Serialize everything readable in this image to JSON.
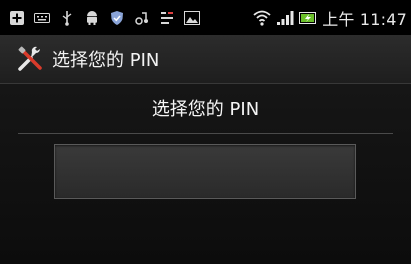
{
  "status_bar": {
    "left_icons": [
      "add-icon",
      "keyboard-icon",
      "usb-icon",
      "android-icon",
      "shield-icon",
      "sync-icon",
      "notification-icon",
      "image-icon"
    ],
    "right_icons": [
      "wifi-icon",
      "signal-icon",
      "battery-icon"
    ],
    "time": "上午 11:47"
  },
  "action_bar": {
    "icon": "settings-tools-icon",
    "title": "选择您的 PIN"
  },
  "main": {
    "prompt": "选择您的 PIN",
    "pin_value": ""
  },
  "colors": {
    "background": "#000000",
    "battery_accent": "#6bbf2a"
  }
}
